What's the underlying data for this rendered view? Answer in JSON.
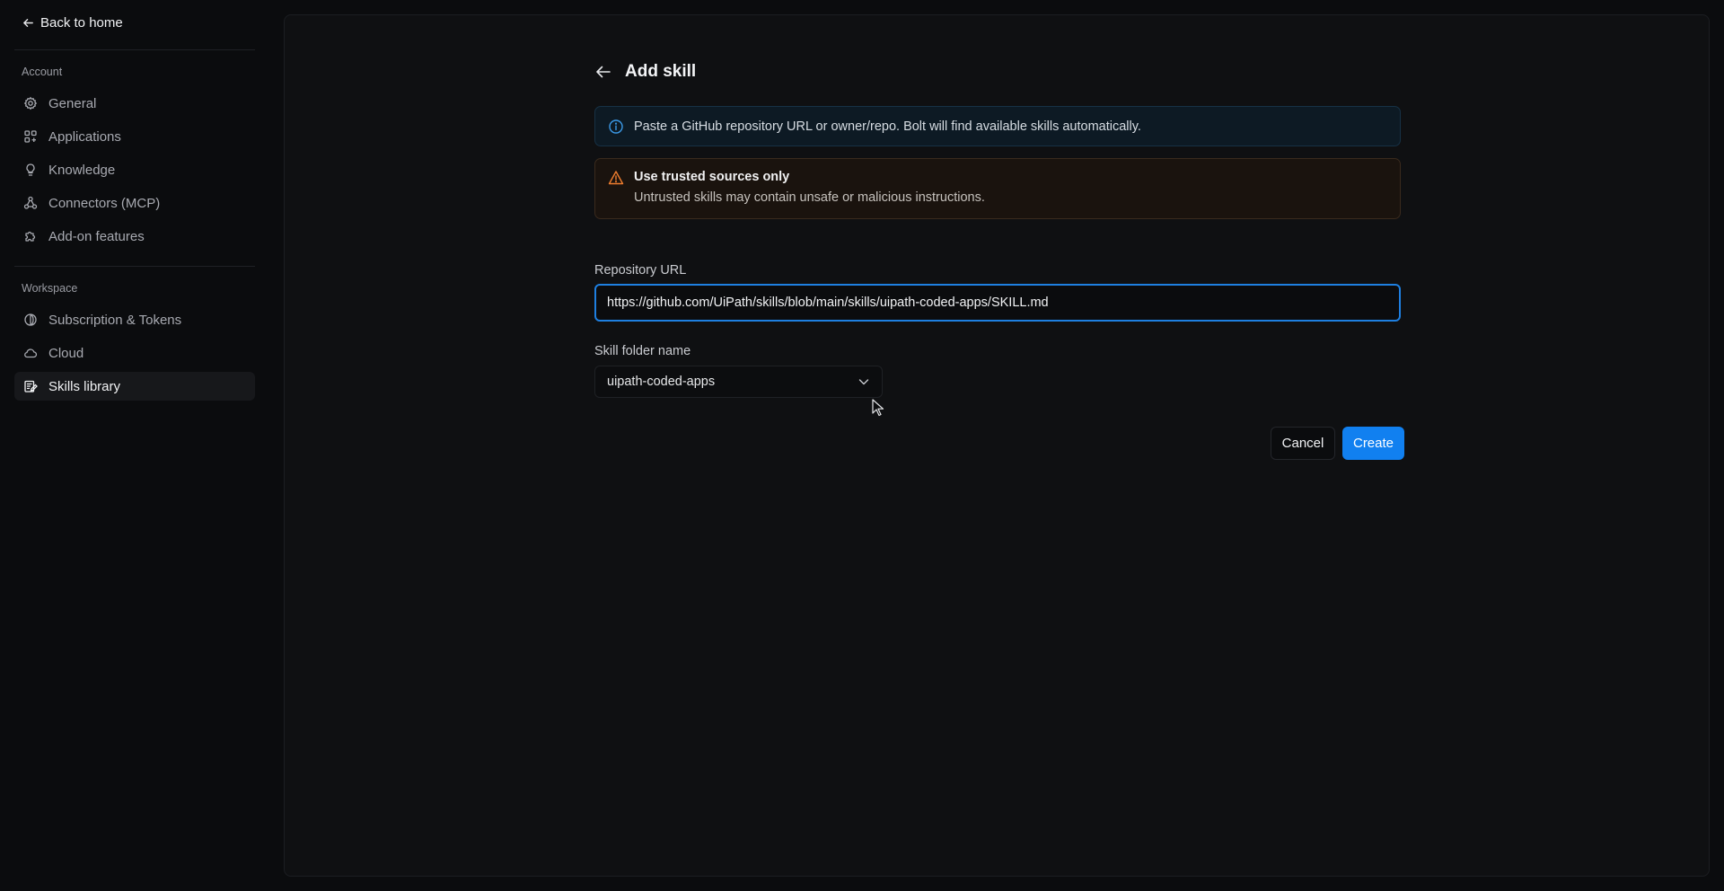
{
  "sidebar": {
    "back_label": "Back to home",
    "account_heading": "Account",
    "account_items": [
      {
        "label": "General",
        "icon": "gear-icon"
      },
      {
        "label": "Applications",
        "icon": "apps-icon"
      },
      {
        "label": "Knowledge",
        "icon": "lightbulb-icon"
      },
      {
        "label": "Connectors (MCP)",
        "icon": "connectors-icon"
      },
      {
        "label": "Add-on features",
        "icon": "puzzle-icon"
      }
    ],
    "workspace_heading": "Workspace",
    "workspace_items": [
      {
        "label": "Subscription & Tokens",
        "icon": "coins-icon"
      },
      {
        "label": "Cloud",
        "icon": "cloud-icon"
      },
      {
        "label": "Skills library",
        "icon": "skills-icon",
        "active": true
      }
    ]
  },
  "page": {
    "title": "Add skill",
    "info_text": "Paste a GitHub repository URL or owner/repo. Bolt will find available skills automatically.",
    "warning_title": "Use trusted sources only",
    "warning_text": "Untrusted skills may contain unsafe or malicious instructions.",
    "repo_label": "Repository URL",
    "repo_value": "https://github.com/UiPath/skills/blob/main/skills/uipath-coded-apps/SKILL.md",
    "folder_label": "Skill folder name",
    "folder_value": "uipath-coded-apps",
    "cancel_label": "Cancel",
    "create_label": "Create"
  },
  "colors": {
    "accent": "#1180f0",
    "info_icon": "#3b9ae8",
    "warning_icon": "#ef7d2e"
  }
}
